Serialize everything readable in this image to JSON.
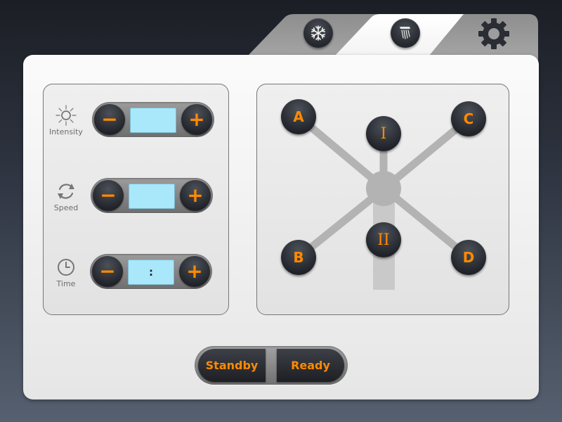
{
  "tabs": [
    {
      "icon": "snowflake-icon",
      "name": "cooling"
    },
    {
      "icon": "shower-icon",
      "name": "shower"
    },
    {
      "icon": "gear-icon",
      "name": "settings"
    }
  ],
  "controls": {
    "intensity": {
      "label": "Intensity",
      "value": ""
    },
    "speed": {
      "label": "Speed",
      "value": ""
    },
    "time": {
      "label": "Time",
      "value": ":"
    },
    "minus_symbol": "−",
    "plus_symbol": "+"
  },
  "diagram": {
    "nodes": {
      "a": "A",
      "b": "B",
      "c": "C",
      "d": "D",
      "i": "I",
      "ii": "II"
    }
  },
  "mode": {
    "standby": "Standby",
    "ready": "Ready"
  },
  "colors": {
    "accent": "#ff8a00",
    "display_bg": "#a9e7fb",
    "line": "#b3b3b3"
  }
}
